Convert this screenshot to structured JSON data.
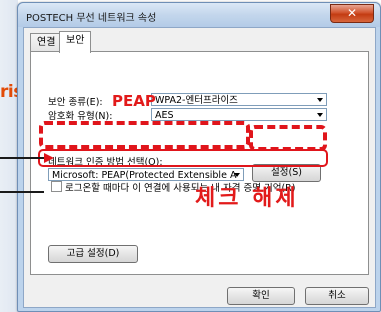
{
  "window": {
    "title": "POSTECH 무선 네트워크 속성",
    "close_symbol": "✕"
  },
  "tabs": [
    {
      "label": "연결",
      "active": false
    },
    {
      "label": "보안",
      "active": true
    }
  ],
  "security": {
    "type_label": "보안 종류(E):",
    "type_value": "WPA2-엔터프라이즈",
    "encryption_label": "암호화 유형(N):",
    "encryption_value": "AES",
    "auth_label": "네트워크 인증 방법 선택(O):",
    "auth_value": "Microsoft: PEAP(Protected Extensible A",
    "settings_button": "설정(S)",
    "remember_checkbox_label": "로그온할 때마다 이 연결에 사용되는 내 자격 증명 기억(R)",
    "remember_checked": false,
    "advanced_button": "고급 설정(D)"
  },
  "footer": {
    "ok_button": "확인",
    "cancel_button": "취소"
  },
  "annotations": {
    "left_fragment": "rise",
    "peap_label": "PEAP",
    "uncheck_label": "체크 해제",
    "color": "#e0151b"
  }
}
